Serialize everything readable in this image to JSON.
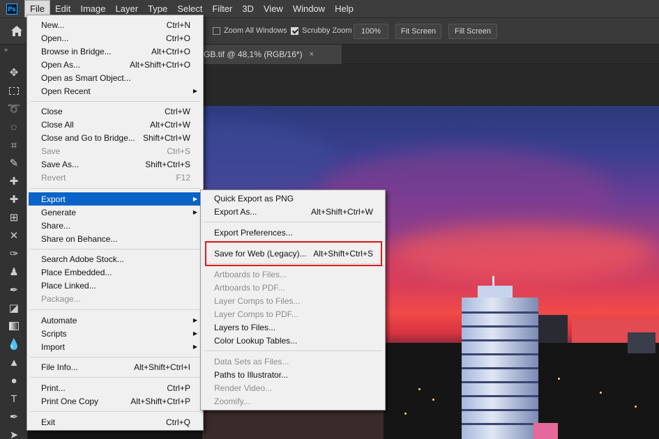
{
  "app": {
    "logo": "Ps"
  },
  "menubar": [
    "File",
    "Edit",
    "Image",
    "Layer",
    "Type",
    "Select",
    "Filter",
    "3D",
    "View",
    "Window",
    "Help"
  ],
  "options": {
    "zoom_all_windows": "Zoom All Windows",
    "scrubby_zoom": "Scrubby Zoom",
    "zoom_value": "100%",
    "fit_screen": "Fit Screen",
    "fill_screen": "Fill Screen"
  },
  "document_tab": {
    "title": "GB.tif @ 48,1% (RGB/16*)",
    "close": "×"
  },
  "file_menu": [
    {
      "label": "New...",
      "shortcut": "Ctrl+N"
    },
    {
      "label": "Open...",
      "shortcut": "Ctrl+O"
    },
    {
      "label": "Browse in Bridge...",
      "shortcut": "Alt+Ctrl+O"
    },
    {
      "label": "Open As...",
      "shortcut": "Alt+Shift+Ctrl+O"
    },
    {
      "label": "Open as Smart Object...",
      "shortcut": ""
    },
    {
      "label": "Open Recent",
      "shortcut": ""
    },
    {
      "label": "Close",
      "shortcut": "Ctrl+W"
    },
    {
      "label": "Close All",
      "shortcut": "Alt+Ctrl+W"
    },
    {
      "label": "Close and Go to Bridge...",
      "shortcut": "Shift+Ctrl+W"
    },
    {
      "label": "Save",
      "shortcut": "Ctrl+S"
    },
    {
      "label": "Save As...",
      "shortcut": "Shift+Ctrl+S"
    },
    {
      "label": "Revert",
      "shortcut": "F12"
    },
    {
      "label": "Export",
      "shortcut": ""
    },
    {
      "label": "Generate",
      "shortcut": ""
    },
    {
      "label": "Share...",
      "shortcut": ""
    },
    {
      "label": "Share on Behance...",
      "shortcut": ""
    },
    {
      "label": "Search Adobe Stock...",
      "shortcut": ""
    },
    {
      "label": "Place Embedded...",
      "shortcut": ""
    },
    {
      "label": "Place Linked...",
      "shortcut": ""
    },
    {
      "label": "Package...",
      "shortcut": ""
    },
    {
      "label": "Automate",
      "shortcut": ""
    },
    {
      "label": "Scripts",
      "shortcut": ""
    },
    {
      "label": "Import",
      "shortcut": ""
    },
    {
      "label": "File Info...",
      "shortcut": "Alt+Shift+Ctrl+I"
    },
    {
      "label": "Print...",
      "shortcut": "Ctrl+P"
    },
    {
      "label": "Print One Copy",
      "shortcut": "Alt+Shift+Ctrl+P"
    },
    {
      "label": "Exit",
      "shortcut": "Ctrl+Q"
    }
  ],
  "export_menu": [
    {
      "label": "Quick Export as PNG",
      "shortcut": ""
    },
    {
      "label": "Export As...",
      "shortcut": "Alt+Shift+Ctrl+W"
    },
    {
      "label": "Export Preferences...",
      "shortcut": ""
    },
    {
      "label": "Save for Web (Legacy)...",
      "shortcut": "Alt+Shift+Ctrl+S"
    },
    {
      "label": "Artboards to Files...",
      "shortcut": ""
    },
    {
      "label": "Artboards to PDF...",
      "shortcut": ""
    },
    {
      "label": "Layer Comps to Files...",
      "shortcut": ""
    },
    {
      "label": "Layer Comps to PDF...",
      "shortcut": ""
    },
    {
      "label": "Layers to Files...",
      "shortcut": ""
    },
    {
      "label": "Color Lookup Tables...",
      "shortcut": ""
    },
    {
      "label": "Data Sets as Files...",
      "shortcut": ""
    },
    {
      "label": "Paths to Illustrator...",
      "shortcut": ""
    },
    {
      "label": "Render Video...",
      "shortcut": ""
    },
    {
      "label": "Zoomify...",
      "shortcut": ""
    }
  ],
  "colors": {
    "highlight": "#0a64c8",
    "annotation": "#e01b1b",
    "ps_blue": "#31a8ff"
  }
}
